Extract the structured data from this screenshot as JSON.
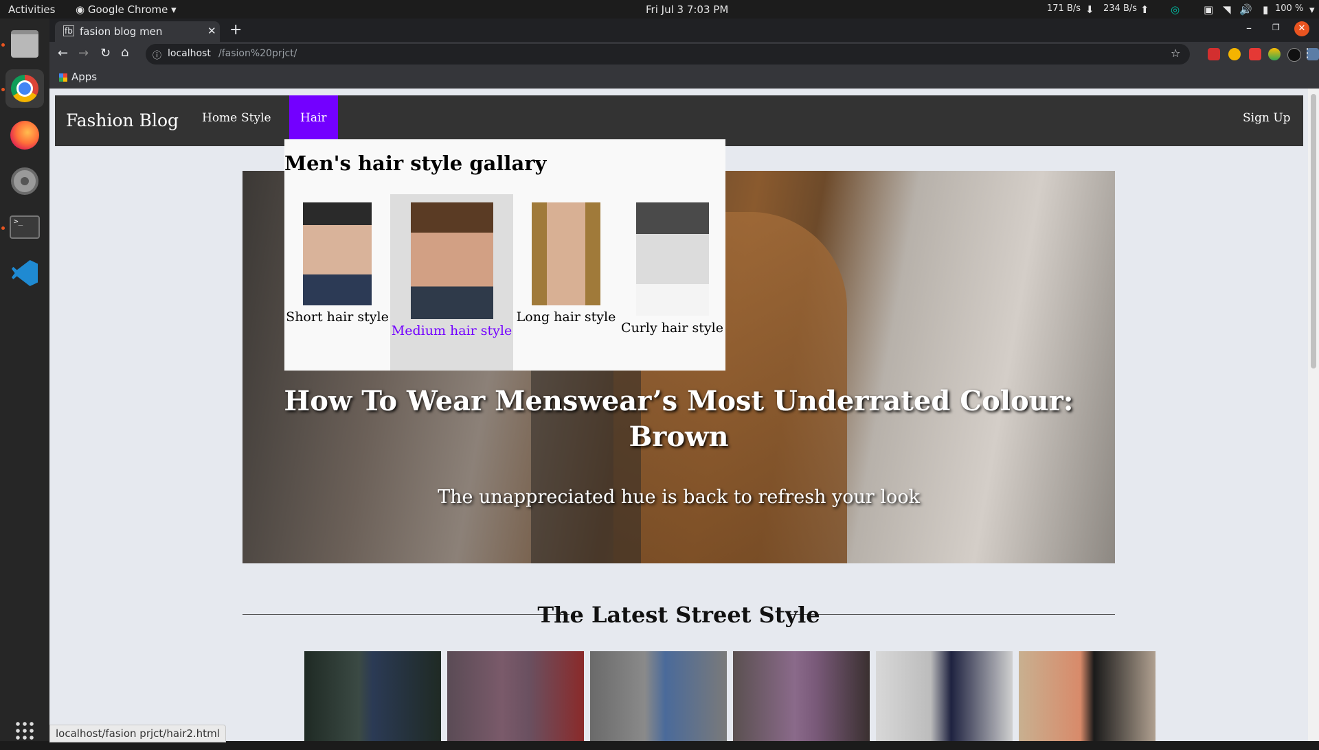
{
  "system_bar": {
    "activities": "Activities",
    "app_name": "Google Chrome",
    "datetime": "Fri Jul 3   7:03 PM",
    "net_down": "171 B/s",
    "net_up": "234 B/s",
    "battery": "100 %"
  },
  "browser": {
    "tab_title": "fasion blog men",
    "url_host": "localhost",
    "url_path": "/fasion%20prjct/",
    "bookmarks_apps": "Apps",
    "status_url": "localhost/fasion prjct/hair2.html"
  },
  "nav": {
    "brand": "Fashion Blog",
    "links": [
      "Home",
      "Style",
      "Hair"
    ],
    "active": "Hair",
    "signup": "Sign Up"
  },
  "dropdown": {
    "title": "Men's hair style gallary",
    "items": [
      {
        "label": "Short hair style"
      },
      {
        "label": "Medium hair style"
      },
      {
        "label": "Long hair style"
      },
      {
        "label": "Curly hair style"
      }
    ],
    "hovered_index": 1
  },
  "hero": {
    "title": "How To Wear Menswear’s Most Underrated Colour: Brown",
    "subtitle": "The unappreciated hue is back to refresh your look"
  },
  "section": {
    "title": "The Latest Street Style",
    "photos": [
      "street-photo-1",
      "street-photo-2",
      "street-photo-3",
      "street-photo-4",
      "street-photo-5",
      "street-photo-6"
    ]
  },
  "colors": {
    "accent": "#7300ff",
    "navbar": "#333333",
    "page_bg": "#e6e9ef"
  }
}
